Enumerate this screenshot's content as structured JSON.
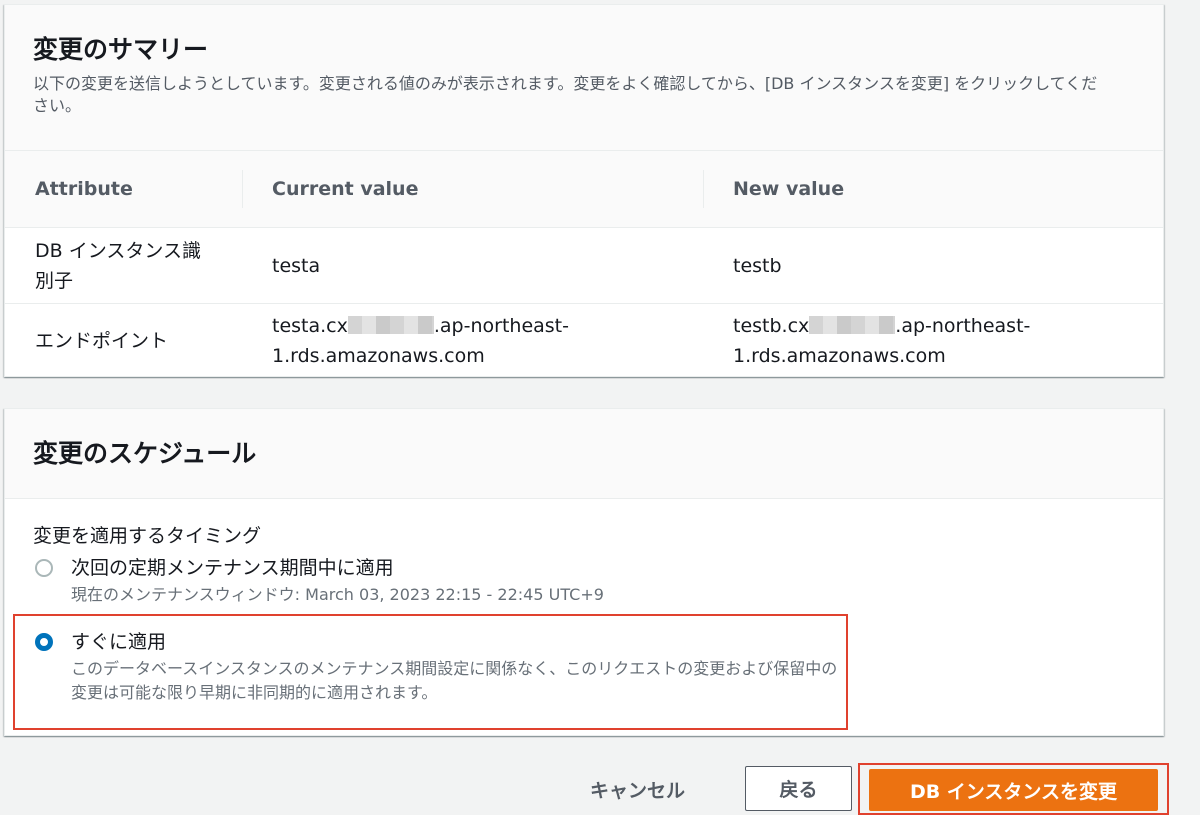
{
  "summary": {
    "title": "変更のサマリー",
    "description": "以下の変更を送信しようとしています。変更される値のみが表示されます。変更をよく確認してから、[DB インスタンスを変更] をクリックしてください。",
    "columns": [
      "Attribute",
      "Current value",
      "New value"
    ],
    "rows": [
      {
        "attribute": "DB インスタンス識別子",
        "current": "testa",
        "new": "testb"
      },
      {
        "attribute": "エンドポイント",
        "current_prefix": "testa.cx",
        "current_suffix": ".ap-northeast-1.rds.amazonaws.com",
        "new_prefix": "testb.cx",
        "new_suffix": ".ap-northeast-1.rds.amazonaws.com"
      }
    ]
  },
  "schedule": {
    "title": "変更のスケジュール",
    "field_label": "変更を適用するタイミング",
    "options": [
      {
        "label": "次回の定期メンテナンス期間中に適用",
        "description": "現在のメンテナンスウィンドウ: March 03, 2023 22:15 - 22:45 UTC+9",
        "selected": false
      },
      {
        "label": "すぐに適用",
        "description": "このデータベースインスタンスのメンテナンス期間設定に関係なく、このリクエストの変更および保留中の変更は可能な限り早期に非同期的に適用されます。",
        "selected": true
      }
    ]
  },
  "footer": {
    "cancel_label": "キャンセル",
    "back_label": "戻る",
    "submit_label": "DB インスタンスを変更"
  },
  "colors": {
    "primary": "#ec7211",
    "selected_radio": "#0073bb",
    "highlight": "#e0412e"
  }
}
